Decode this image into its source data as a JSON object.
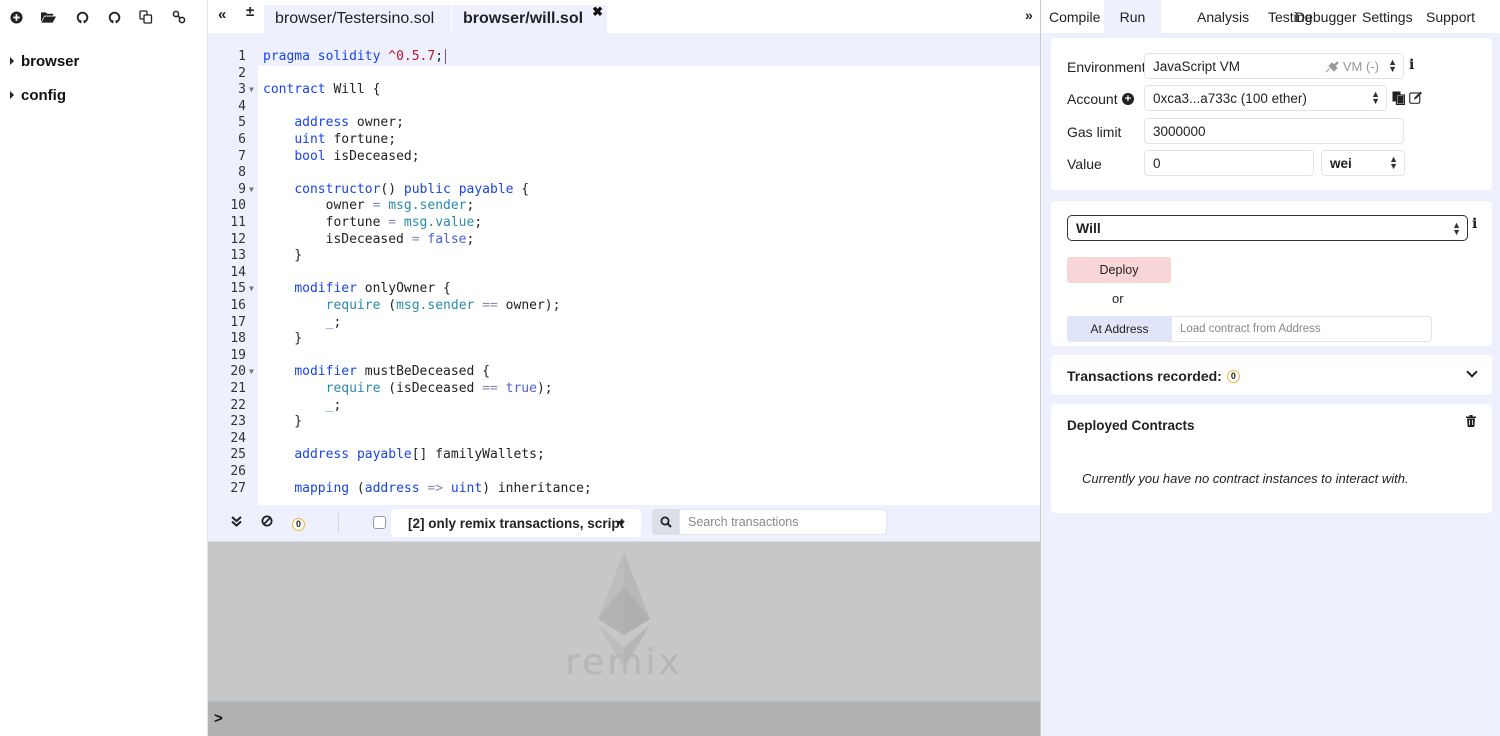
{
  "file_panel": {
    "toolbar_icons": [
      "new-file-icon",
      "open-folder-icon",
      "github-gist-icon",
      "github-icon",
      "copy-files-icon",
      "link-localhost-icon"
    ],
    "tree": [
      {
        "label": "browser"
      },
      {
        "label": "config"
      }
    ]
  },
  "editor": {
    "tabs": [
      {
        "label": "browser/Testersino.sol",
        "active": false
      },
      {
        "label": "browser/will.sol",
        "active": true
      }
    ],
    "close_glyph": "✖",
    "collapse_glyph": "«",
    "zoom_glyph": "±",
    "language": "solidity",
    "lines": [
      {
        "n": "1",
        "fold": false,
        "html": "<span class=\"k\">pragma</span> <span class=\"k\">solidity</span> <span class=\"n\">^0.5.7</span>;"
      },
      {
        "n": "2",
        "fold": false,
        "html": ""
      },
      {
        "n": "3",
        "fold": true,
        "html": "<span class=\"k\">contract</span> Will {"
      },
      {
        "n": "4",
        "fold": false,
        "html": ""
      },
      {
        "n": "5",
        "fold": false,
        "html": "    <span class=\"k\">address</span> owner;"
      },
      {
        "n": "6",
        "fold": false,
        "html": "    <span class=\"k\">uint</span> fortune;"
      },
      {
        "n": "7",
        "fold": false,
        "html": "    <span class=\"k\">bool</span> isDeceased;"
      },
      {
        "n": "8",
        "fold": false,
        "html": ""
      },
      {
        "n": "9",
        "fold": true,
        "html": "    <span class=\"k\">constructor</span>() <span class=\"k\">public</span> <span class=\"k\">payable</span> {"
      },
      {
        "n": "10",
        "fold": false,
        "html": "        owner <span class=\"o\">=</span> <span class=\"b\">msg.sender</span>;"
      },
      {
        "n": "11",
        "fold": false,
        "html": "        fortune <span class=\"o\">=</span> <span class=\"b\">msg.value</span>;"
      },
      {
        "n": "12",
        "fold": false,
        "html": "        isDeceased <span class=\"o\">=</span> <span class=\"l\">false</span>;"
      },
      {
        "n": "13",
        "fold": false,
        "html": "    }"
      },
      {
        "n": "14",
        "fold": false,
        "html": ""
      },
      {
        "n": "15",
        "fold": true,
        "html": "    <span class=\"k\">modifier</span> onlyOwner {"
      },
      {
        "n": "16",
        "fold": false,
        "html": "        <span class=\"b\">require</span> (<span class=\"b\">msg.sender</span> <span class=\"o\">==</span> owner);"
      },
      {
        "n": "17",
        "fold": false,
        "html": "        <span class=\"b\">_</span>;"
      },
      {
        "n": "18",
        "fold": false,
        "html": "    }"
      },
      {
        "n": "19",
        "fold": false,
        "html": ""
      },
      {
        "n": "20",
        "fold": true,
        "html": "    <span class=\"k\">modifier</span> mustBeDeceased {"
      },
      {
        "n": "21",
        "fold": false,
        "html": "        <span class=\"b\">require</span> (isDeceased <span class=\"o\">==</span> <span class=\"l\">true</span>);"
      },
      {
        "n": "22",
        "fold": false,
        "html": "        <span class=\"b\">_</span>;"
      },
      {
        "n": "23",
        "fold": false,
        "html": "    }"
      },
      {
        "n": "24",
        "fold": false,
        "html": ""
      },
      {
        "n": "25",
        "fold": false,
        "html": "    <span class=\"k\">address</span> <span class=\"k\">payable</span>[] familyWallets;"
      },
      {
        "n": "26",
        "fold": false,
        "html": ""
      },
      {
        "n": "27",
        "fold": false,
        "html": "    <span class=\"k\">mapping</span> (<span class=\"k\">address</span> <span class=\"o\">=></span> <span class=\"k\">uint</span>) inheritance;"
      }
    ]
  },
  "terminal": {
    "pending_count": "0",
    "filter_label": "[2] only remix transactions, script",
    "search_placeholder": "Search transactions",
    "logo_text": "remix",
    "prompt": ">"
  },
  "right_panel": {
    "toggle_glyph": "»",
    "tabs": [
      {
        "label": "Compile",
        "active": false
      },
      {
        "label": "Run",
        "active": true
      },
      {
        "label": "Analysis",
        "active": false
      },
      {
        "label": "Testing",
        "active": false
      },
      {
        "label": "Debugger",
        "active": false
      },
      {
        "label": "Settings",
        "active": false
      },
      {
        "label": "Support",
        "active": false
      }
    ],
    "settings": {
      "environment_label": "Environment",
      "environment_value": "JavaScript VM",
      "environment_network": "VM (-)",
      "account_label": "Account",
      "account_value": "0xca3...a733c (100 ether)",
      "gas_limit_label": "Gas limit",
      "gas_limit_value": "3000000",
      "value_label": "Value",
      "value_amount": "0",
      "value_unit": "wei"
    },
    "deploy": {
      "contract_selected": "Will",
      "deploy_label": "Deploy",
      "or_label": "or",
      "at_address_label": "At Address",
      "at_address_placeholder": "Load contract from Address"
    },
    "transactions": {
      "title": "Transactions recorded:",
      "count": "0"
    },
    "deployed": {
      "title": "Deployed Contracts",
      "empty_message": "Currently you have no contract instances to interact with."
    },
    "colors": {
      "panel_bg": "#eef0fd",
      "deploy_bg": "#f8d5d7",
      "at_address_bg": "#e0e5f9",
      "badge_border": "#f0b73a"
    }
  }
}
